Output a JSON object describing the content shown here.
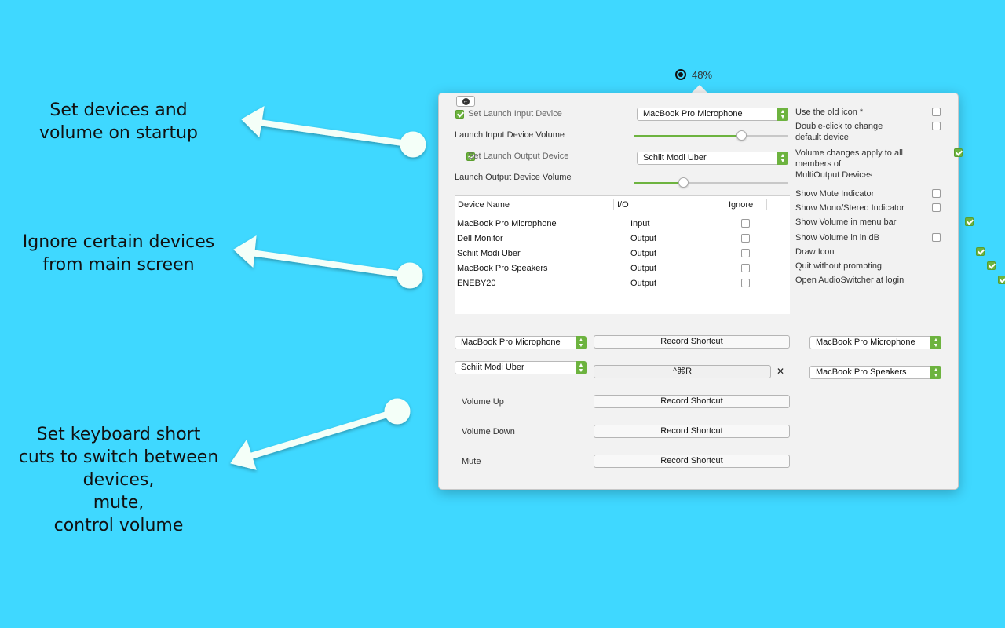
{
  "callouts": {
    "startup": "Set devices and\nvolume on startup",
    "ignore": "Ignore certain devices\nfrom main screen",
    "shortcuts": "Set keyboard short\ncuts to switch between\ndevices,\nmute,\ncontrol volume"
  },
  "menubar": {
    "volume": "48%"
  },
  "launch": {
    "set_input_label": "Set Launch Input Device",
    "input_device": "MacBook Pro Microphone",
    "input_volume_label": "Launch Input Device Volume",
    "input_volume": 0.7,
    "set_output_label": "Set Launch Output Device",
    "output_device": "Schiit Modi Uber",
    "output_volume_label": "Launch Output Device Volume",
    "output_volume": 0.32
  },
  "table": {
    "headers": [
      "Device Name",
      "I/O",
      "Ignore"
    ],
    "rows": [
      {
        "name": "MacBook Pro Microphone",
        "io": "Input"
      },
      {
        "name": "Dell Monitor",
        "io": "Output"
      },
      {
        "name": "Schiit Modi Uber",
        "io": "Output"
      },
      {
        "name": "MacBook Pro Speakers",
        "io": "Output"
      },
      {
        "name": "ENEBY20",
        "io": "Output"
      }
    ]
  },
  "options": [
    {
      "label": "Use the old icon *",
      "checked": false
    },
    {
      "label": "Double-click to change\ndefault device",
      "checked": false
    },
    {
      "label": "Volume changes apply to all\nmembers of\nMultiOutput Devices",
      "checked": true
    },
    {
      "label": "Show Mute Indicator",
      "checked": false
    },
    {
      "label": "Show Mono/Stereo Indicator",
      "checked": false
    },
    {
      "label": "Show Volume in menu bar",
      "checked": true
    },
    {
      "label": "Show Volume in in dB",
      "checked": false
    },
    {
      "label": "Draw Icon",
      "checked": true
    },
    {
      "label": "Quit without prompting",
      "checked": true
    },
    {
      "label": "Open AudioSwitcher at login",
      "checked": true
    }
  ],
  "shortcuts": {
    "row1_left": "MacBook Pro Microphone",
    "row1_button": "Record Shortcut",
    "row1_right": "MacBook Pro Microphone",
    "row2_left": "Schiit Modi Uber",
    "row2_shortcut": "^⌘R",
    "row2_clear": "✕",
    "row2_right": "MacBook Pro Speakers",
    "volume_up_label": "Volume Up",
    "volume_up_button": "Record Shortcut",
    "volume_down_label": "Volume Down",
    "volume_down_button": "Record Shortcut",
    "mute_label": "Mute",
    "mute_button": "Record Shortcut"
  }
}
